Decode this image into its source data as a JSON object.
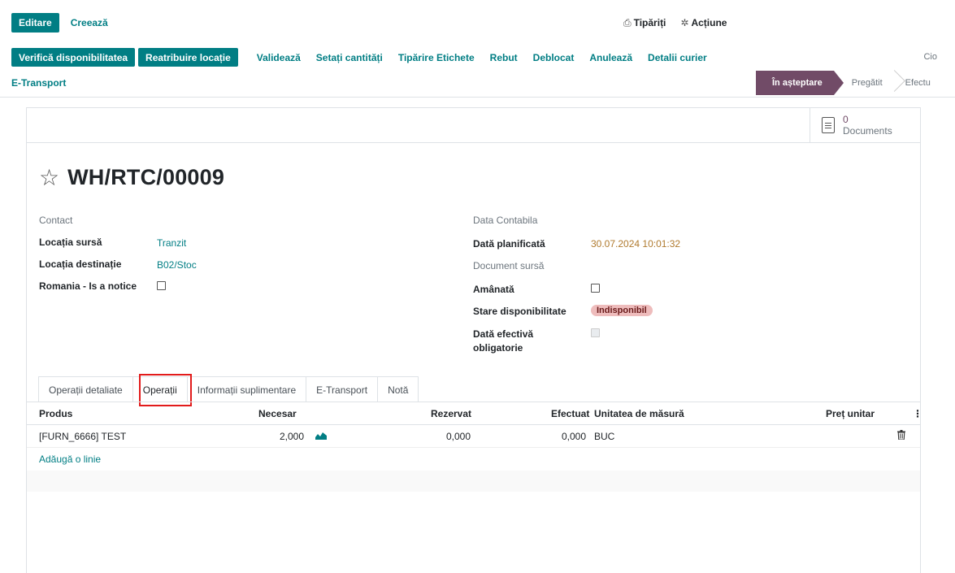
{
  "toolbar": {
    "edit_label": "Editare",
    "create_label": "Creează",
    "print_label": "Tipăriți",
    "action_label": "Acțiune"
  },
  "actions": {
    "check_availability": "Verifică disponibilitatea",
    "reassign_location": "Reatribuire locație",
    "validate": "Validează",
    "set_quantities": "Setați cantități",
    "print_labels": "Tipărire Etichete",
    "scrap": "Rebut",
    "unlock": "Deblocat",
    "cancel": "Anulează",
    "courier_details": "Detalii curier",
    "cio": "Cio",
    "etransport": "E-Transport"
  },
  "status": {
    "stages": [
      "În așteptare",
      "Pregătit",
      "Efectu"
    ],
    "active_index": 0
  },
  "buttonbox": {
    "docs_count": "0",
    "docs_label": "Documents"
  },
  "record": {
    "name": "WH/RTC/00009"
  },
  "left_fields": {
    "contact_label": "Contact",
    "source_label": "Locația sursă",
    "source_value": "Tranzit",
    "dest_label": "Locația destinație",
    "dest_value": "B02/Stoc",
    "notice_label": "Romania - Is a notice"
  },
  "right_fields": {
    "accounting_date_label": "Data Contabila",
    "scheduled_label": "Dată planificată",
    "scheduled_value": "30.07.2024 10:01:32",
    "source_doc_label": "Document sursă",
    "postponed_label": "Amânată",
    "availability_label": "Stare disponibilitate",
    "availability_value": "Indisponibil",
    "effective_date_label": "Dată efectivă obligatorie"
  },
  "tabs": [
    "Operații detaliate",
    "Operații",
    "Informații suplimentare",
    "E-Transport",
    "Notă"
  ],
  "table": {
    "headers": {
      "product": "Produs",
      "demand": "Necesar",
      "reserved": "Rezervat",
      "done": "Efectuat",
      "uom": "Unitatea de măsură",
      "unit_price": "Preț unitar"
    },
    "rows": [
      {
        "product": "[FURN_6666] TEST",
        "demand": "2,000",
        "reserved": "0,000",
        "done": "0,000",
        "uom": "BUC",
        "unit_price": ""
      }
    ],
    "add_line": "Adăugă o linie"
  },
  "icons": {
    "print": "print-icon",
    "action": "gear-icon",
    "star": "star-icon",
    "doc": "document-icon",
    "forecast": "area-chart-icon",
    "trash": "trash-icon",
    "more": "vertical-dots-icon"
  },
  "colors": {
    "primary": "#017e84",
    "brand": "#714b67",
    "highlight_box": "#e21b1b",
    "badge_bg": "#eebcbc"
  }
}
